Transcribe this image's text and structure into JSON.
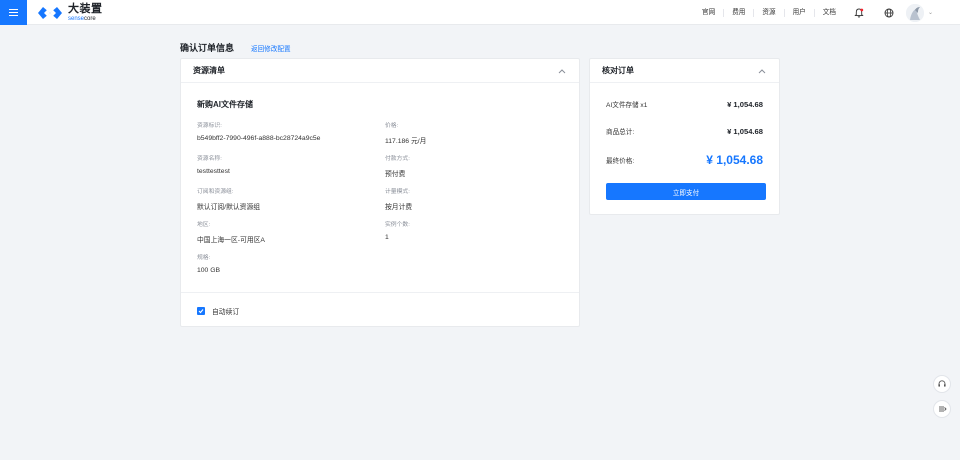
{
  "app": {
    "logo_cn": "大装置",
    "logo_en_blue": "sense",
    "logo_en_dark": "core"
  },
  "nav": {
    "items": [
      {
        "label": "官网"
      },
      {
        "label": "费用"
      },
      {
        "label": "资源"
      },
      {
        "label": "用户"
      },
      {
        "label": "文档"
      }
    ],
    "icons": [
      "bell-icon",
      "globe-icon",
      "avatar",
      "chevron-down-icon"
    ]
  },
  "page": {
    "title": "确认订单信息",
    "back_link": "返回修改配置"
  },
  "resource_card": {
    "title": "资源清单",
    "product_name": "新购AI文件存储",
    "fields": [
      {
        "label": "资源标识:",
        "value": "b549bff2-7990-496f-a888-bc28724a9c5e"
      },
      {
        "label": "价格:",
        "value": "117.186 元/月"
      },
      {
        "label": "资源名称:",
        "value": "testtesttest"
      },
      {
        "label": "付款方式:",
        "value": "预付费"
      },
      {
        "label": "订阅和资源组:",
        "value": "默认订阅/默认资源组"
      },
      {
        "label": "计量模式:",
        "value": "按月计费"
      },
      {
        "label": "地区:",
        "value": "中国上海一区-可用区A"
      },
      {
        "label": "实例个数:",
        "value": "1"
      },
      {
        "label": "规格:",
        "value": "100 GB"
      }
    ],
    "auto_renew_label": "自动续订",
    "auto_renew_checked": true
  },
  "order_card": {
    "title": "核对订单",
    "line_item_label": "AI文件存储  x1",
    "line_item_value": "¥ 1,054.68",
    "total_label": "商品总计:",
    "total_value": "¥ 1,054.68",
    "final_label": "最终价格:",
    "final_value": "¥ 1,054.68",
    "pay_button": "立即支付"
  },
  "colors": {
    "accent": "#1677ff",
    "page_bg": "#f2f4f7",
    "notification": "#f5222d"
  },
  "floating": [
    "headset-icon",
    "collapse-list-icon"
  ]
}
